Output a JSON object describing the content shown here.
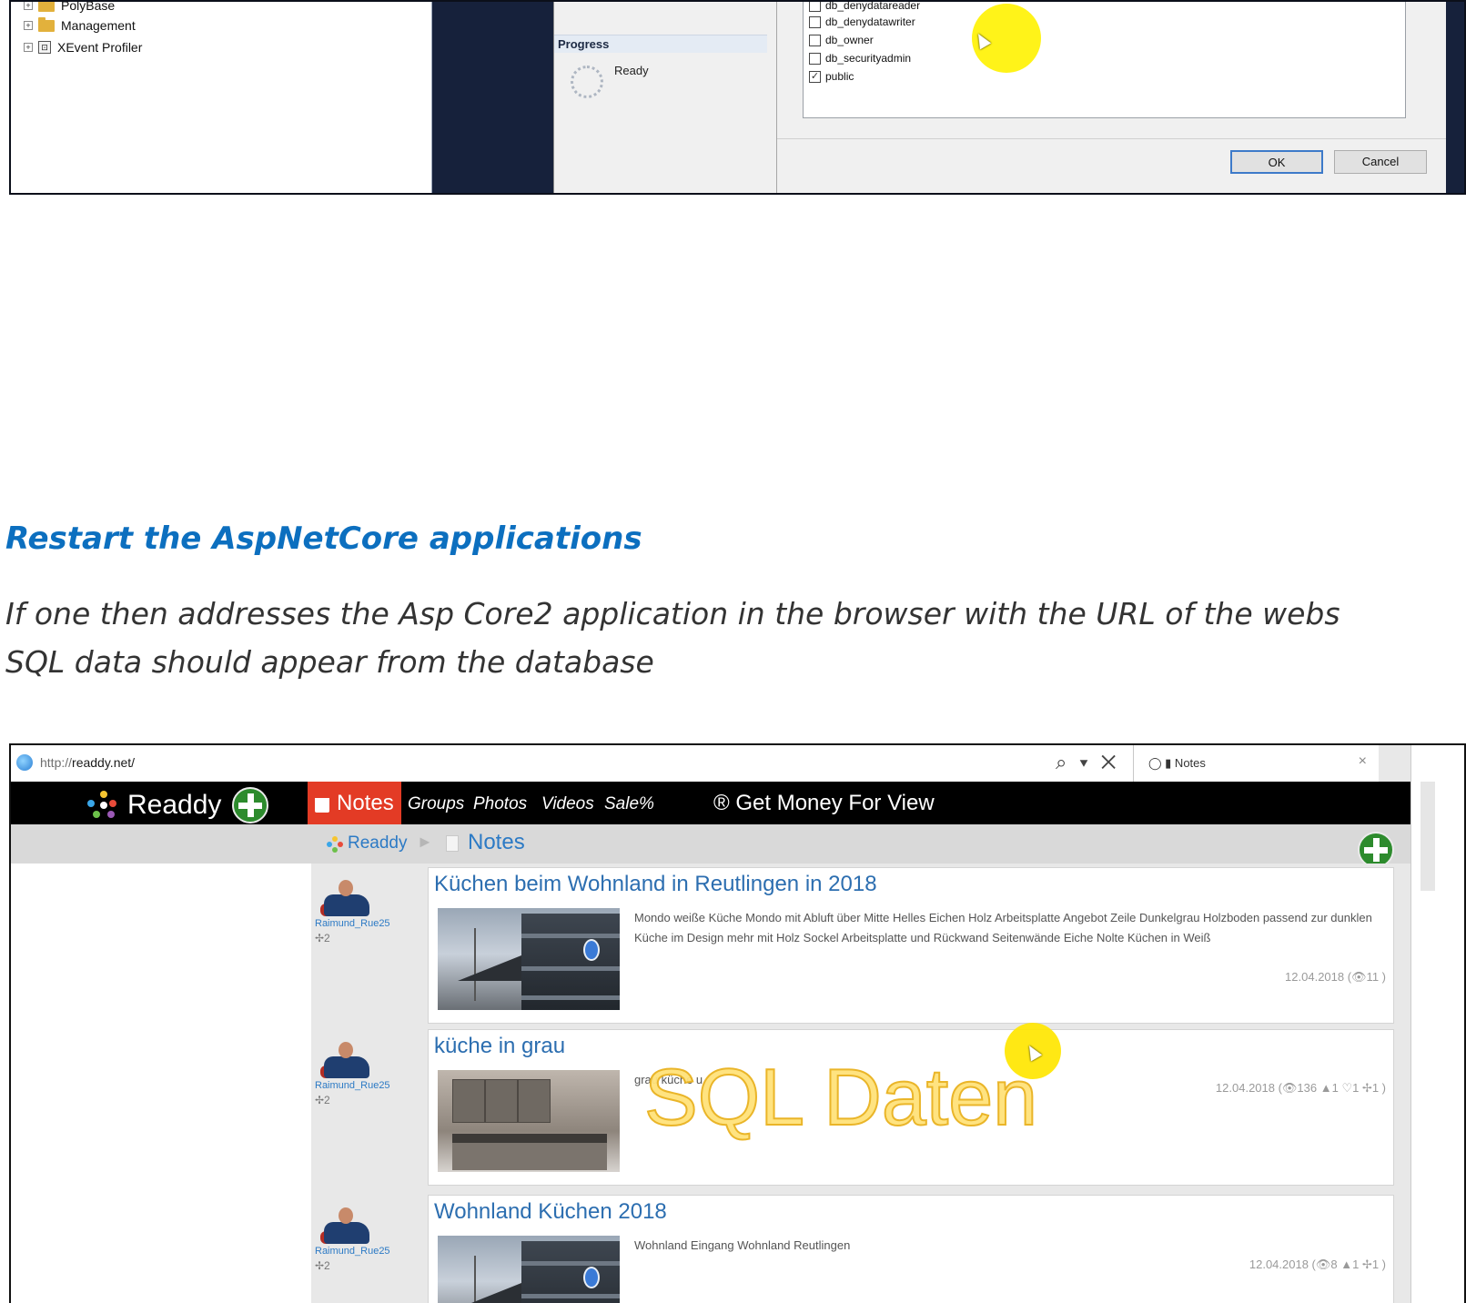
{
  "ssms": {
    "tree": [
      {
        "label": "PolyBase",
        "icon": "folder-icon"
      },
      {
        "label": "Management",
        "icon": "folder-icon"
      },
      {
        "label": "XEvent Profiler",
        "icon": "profiler-icon"
      }
    ],
    "progress_header": "Progress",
    "progress_status": "Ready",
    "roles": [
      {
        "label": "db_denydatareader",
        "checked": false
      },
      {
        "label": "db_denydatawriter",
        "checked": false
      },
      {
        "label": "db_owner",
        "checked": false
      },
      {
        "label": "db_securityadmin",
        "checked": false
      },
      {
        "label": "public",
        "checked": true
      }
    ],
    "ok_label": "OK",
    "cancel_label": "Cancel"
  },
  "article": {
    "heading": "Restart the AspNetCore applications",
    "body_line1": "If one then addresses the Asp Core2 application in the browser with the URL of the webs",
    "body_line2": "SQL data should appear from the database"
  },
  "browser": {
    "url_prefix": "http://",
    "url_domain": "readdy.net/",
    "addr_icons": "⌕ ▾ ✕",
    "tab_label": "◯ ▮ Notes",
    "tab_close": "×"
  },
  "site": {
    "brand": "Readdy",
    "nav_active": "Notes",
    "nav_links": [
      "Groups",
      "Photos",
      "Videos",
      "Sale%"
    ],
    "nav_money": "® Get Money For View",
    "breadcrumb_home": "Readdy",
    "breadcrumb_sep": "►",
    "breadcrumb_current": "Notes"
  },
  "notes": [
    {
      "author": "Raimund_Rue25",
      "pins": "✢2",
      "title": "Küchen beim Wohnland in Reutlingen in 2018",
      "description": "Mondo weiße Küche Mondo mit Abluft über Mitte Helles Eichen Holz Arbeitsplatte Angebot Zeile Dunkelgrau Holzboden passend zur dunklen Küche im Design mehr mit Holz Sockel Arbeitsplatte und Rückwand Seitenwände Eiche Nolte Küchen in Weiß",
      "meta": "12.04.2018 (👁11 )"
    },
    {
      "author": "Raimund_Rue25",
      "pins": "✢2",
      "title": "küche in grau",
      "description": "grau küche u",
      "meta": "12.04.2018 (👁136 ▲1 ♡1 ✢1 )"
    },
    {
      "author": "Raimund_Rue25",
      "pins": "✢2",
      "title": "Wohnland Küchen 2018",
      "description": "Wohnland Eingang Wohnland Reutlingen",
      "meta": "12.04.2018 (👁8 ▲1 ✢1 )"
    }
  ],
  "overlay_text": "SQL Daten",
  "colors": {
    "brand_red": "#e33b25",
    "link_blue": "#2c7ac5",
    "heading_blue": "#0c6fbf",
    "plus_green": "#2d8b2d",
    "highlight_yellow": "#ffe600"
  }
}
